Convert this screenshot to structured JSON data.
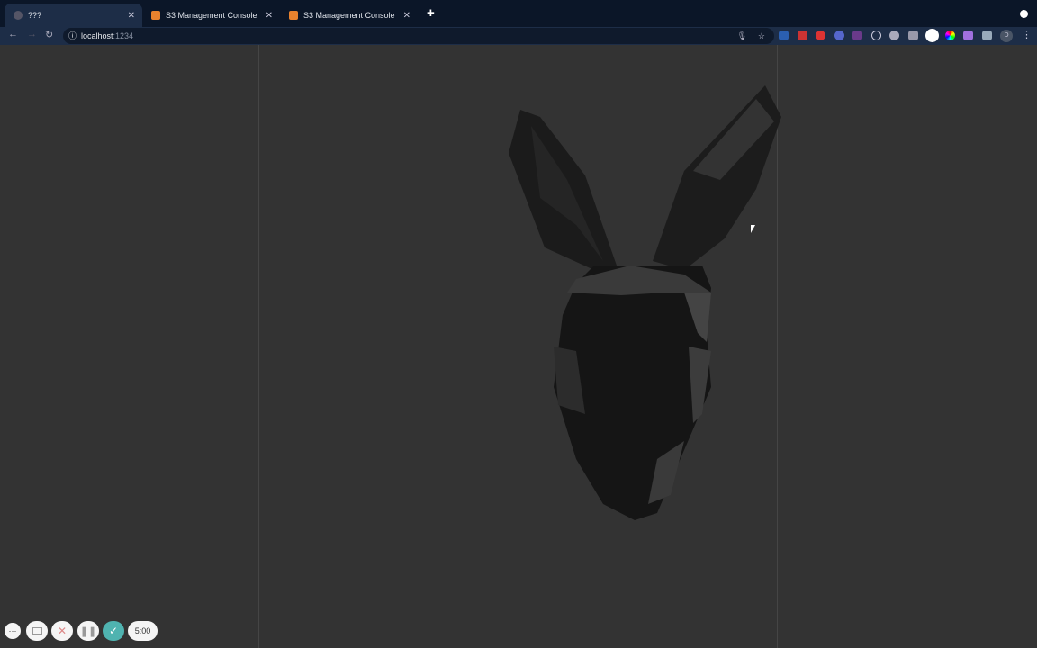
{
  "browser": {
    "tabs": [
      {
        "title": "???",
        "active": true,
        "icon": "globe-icon"
      },
      {
        "title": "S3 Management Console",
        "active": false,
        "icon": "aws-s3-icon"
      },
      {
        "title": "S3 Management Console",
        "active": false,
        "icon": "aws-s3-icon"
      }
    ],
    "new_tab": "+",
    "address": {
      "host": "localhost",
      "port": ":1234"
    },
    "extensions": [
      "word-icon",
      "youtube-icon",
      "record-icon",
      "bug-icon",
      "dev-icon",
      "react-icon",
      "cloud-icon",
      "camera-icon",
      "font-icon",
      "color-icon",
      "gem-icon",
      "puzzle-icon"
    ],
    "profile_initial": "D"
  },
  "recorder": {
    "timer": "5:00",
    "more": "···",
    "accent": "#4fb3b0"
  }
}
